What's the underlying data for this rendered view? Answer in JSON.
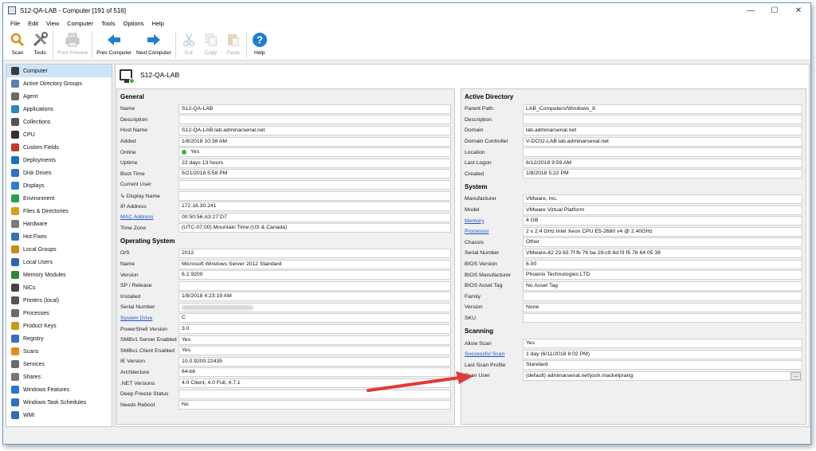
{
  "window": {
    "title": "S12-QA-LAB - Computer [191 of 516]",
    "controls": {
      "minimize": "—",
      "maximize": "☐",
      "close": "✕"
    }
  },
  "menu": [
    "File",
    "Edit",
    "View",
    "Computer",
    "Tools",
    "Options",
    "Help"
  ],
  "toolbar": {
    "scan": "Scan",
    "tools": "Tools",
    "print_preview": "Print Preview",
    "prev_computer": "Prev Computer",
    "next_computer": "Next Computer",
    "cut": "Cut",
    "copy": "Copy",
    "paste": "Paste",
    "help": "Help"
  },
  "sidebar": {
    "items": [
      {
        "label": "Computer",
        "icon": "computer-icon",
        "color": "#3a3a3a"
      },
      {
        "label": "Active Directory Groups",
        "icon": "ad-groups-icon",
        "color": "#5a7fb5"
      },
      {
        "label": "Agent",
        "icon": "agent-icon",
        "color": "#6a6a6a"
      },
      {
        "label": "Applications",
        "icon": "applications-icon",
        "color": "#2e86c1"
      },
      {
        "label": "Collections",
        "icon": "collections-icon",
        "color": "#555555"
      },
      {
        "label": "CPU",
        "icon": "cpu-icon",
        "color": "#333333"
      },
      {
        "label": "Custom Fields",
        "icon": "custom-fields-icon",
        "color": "#c0392b"
      },
      {
        "label": "Deployments",
        "icon": "deployments-icon",
        "color": "#1f6fb5"
      },
      {
        "label": "Disk Drives",
        "icon": "disk-drives-icon",
        "color": "#2e75c9"
      },
      {
        "label": "Displays",
        "icon": "displays-icon",
        "color": "#2a7fd4"
      },
      {
        "label": "Environment",
        "icon": "environment-icon",
        "color": "#2a9d4a"
      },
      {
        "label": "Files & Directories",
        "icon": "files-icon",
        "color": "#d4a017"
      },
      {
        "label": "Hardware",
        "icon": "hardware-icon",
        "color": "#7a7a7a"
      },
      {
        "label": "Hot Fixes",
        "icon": "hot-fixes-icon",
        "color": "#3a6fb0"
      },
      {
        "label": "Local Groups",
        "icon": "local-groups-icon",
        "color": "#c78b1a"
      },
      {
        "label": "Local Users",
        "icon": "local-users-icon",
        "color": "#2a67b3"
      },
      {
        "label": "Memory Modules",
        "icon": "memory-icon",
        "color": "#2d8a3a"
      },
      {
        "label": "NICs",
        "icon": "nics-icon",
        "color": "#444444"
      },
      {
        "label": "Printers (local)",
        "icon": "printers-icon",
        "color": "#555555"
      },
      {
        "label": "Processes",
        "icon": "processes-icon",
        "color": "#6c6c6c"
      },
      {
        "label": "Product Keys",
        "icon": "product-keys-icon",
        "color": "#c59a1a"
      },
      {
        "label": "Registry",
        "icon": "registry-icon",
        "color": "#3d6fb8"
      },
      {
        "label": "Scans",
        "icon": "scans-icon",
        "color": "#e08e1b"
      },
      {
        "label": "Services",
        "icon": "services-icon",
        "color": "#6a6a6a"
      },
      {
        "label": "Shares",
        "icon": "shares-icon",
        "color": "#777777"
      },
      {
        "label": "Windows Features",
        "icon": "windows-features-icon",
        "color": "#2b78d2"
      },
      {
        "label": "Windows Task Schedules",
        "icon": "task-schedules-icon",
        "color": "#2a70c0"
      },
      {
        "label": "WMI",
        "icon": "wmi-icon",
        "color": "#2f6db5"
      }
    ]
  },
  "main": {
    "computer_name": "S12-QA-LAB",
    "general": {
      "title": "General",
      "rows": [
        {
          "k": "Name",
          "v": "S12-QA-LAB"
        },
        {
          "k": "Description",
          "v": ""
        },
        {
          "k": "Host Name",
          "v": "S12-QA-LAB.lab.adminarsenal.net"
        },
        {
          "k": "Added",
          "v": "1/8/2018 10:38 AM"
        },
        {
          "k": "Online",
          "v": "Yes"
        },
        {
          "k": "Uptime",
          "v": "22 days 13 hours"
        },
        {
          "k": "Boot Time",
          "v": "5/21/2018 5:58 PM"
        },
        {
          "k": "Current User",
          "v": ""
        },
        {
          "k": "↳ Display Name",
          "v": ""
        },
        {
          "k": "IP Address",
          "v": "172.16.30.241"
        },
        {
          "k": "MAC Address",
          "v": "00:50:56:A3:27:D7"
        },
        {
          "k": "Time Zone",
          "v": "(UTC-07:00) Mountain Time (US & Canada)"
        }
      ]
    },
    "os": {
      "title": "Operating System",
      "rows": [
        {
          "k": "O/S",
          "v": "2012"
        },
        {
          "k": "Name",
          "v": "Microsoft Windows Server 2012 Standard"
        },
        {
          "k": "Version",
          "v": "6.2.9200"
        },
        {
          "k": "SP / Release",
          "v": ""
        },
        {
          "k": "Installed",
          "v": "1/8/2018 4:23:19 AM"
        },
        {
          "k": "Serial Number",
          "v": ""
        },
        {
          "k": "System Drive",
          "v": "C"
        },
        {
          "k": "PowerShell Version",
          "v": "3.0"
        },
        {
          "k": "SMBv1 Server Enabled",
          "v": "Yes"
        },
        {
          "k": "SMBv1 Client Enabled",
          "v": "Yes"
        },
        {
          "k": "IE Version",
          "v": "10.0.9200.22435"
        },
        {
          "k": "Architecture",
          "v": "64-bit"
        },
        {
          "k": ".NET Versions",
          "v": "4.0 Client, 4.0 Full, 4.7.1"
        },
        {
          "k": "Deep Freeze Status",
          "v": ""
        },
        {
          "k": "Needs Reboot",
          "v": "No"
        }
      ]
    },
    "ad": {
      "title": "Active Directory",
      "rows": [
        {
          "k": "Parent Path",
          "v": "LAB_Computers/Windows_8"
        },
        {
          "k": "Description",
          "v": ""
        },
        {
          "k": "Domain",
          "v": "lab.adminarsenal.net"
        },
        {
          "k": "Domain Controller",
          "v": "V-DC02-LAB.lab.adminarsenal.net"
        },
        {
          "k": "Location",
          "v": ""
        },
        {
          "k": "Last Logon",
          "v": "6/12/2018 9:59 AM"
        },
        {
          "k": "Created",
          "v": "1/8/2018 5:22 PM"
        }
      ]
    },
    "system": {
      "title": "System",
      "rows": [
        {
          "k": "Manufacturer",
          "v": "VMware, Inc."
        },
        {
          "k": "Model",
          "v": "VMware Virtual Platform"
        },
        {
          "k": "Memory",
          "v": "4 GB"
        },
        {
          "k": "Processor",
          "v": "2 x 2.4 GHz Intel Xeon CPU E5-2680 v4 @ 2.40GHz"
        },
        {
          "k": "Chassis",
          "v": "Other"
        },
        {
          "k": "Serial Number",
          "v": "VMware-42 23 63 7f fb 76 ba 29-c9 8d f3 f5 78 64 05 39"
        },
        {
          "k": "BIOS Version",
          "v": "6.00"
        },
        {
          "k": "BIOS Manufacturer",
          "v": "Phoenix Technologies LTD"
        },
        {
          "k": "BIOS Asset Tag",
          "v": "No Asset Tag"
        },
        {
          "k": "Family",
          "v": ""
        },
        {
          "k": "Version",
          "v": "None"
        },
        {
          "k": "SKU",
          "v": ""
        }
      ]
    },
    "scanning": {
      "title": "Scanning",
      "rows": [
        {
          "k": "Allow Scan",
          "v": "Yes"
        },
        {
          "k": "Successful Scan",
          "v": "1 day (6/11/2018 8:02 PM)"
        },
        {
          "k": "Last Scan Profile",
          "v": "Standard"
        },
        {
          "k": "Scan User",
          "v": "(default)  adminarsenal.net\\josh.mackelprang"
        }
      ],
      "ellipsis": "..."
    }
  }
}
